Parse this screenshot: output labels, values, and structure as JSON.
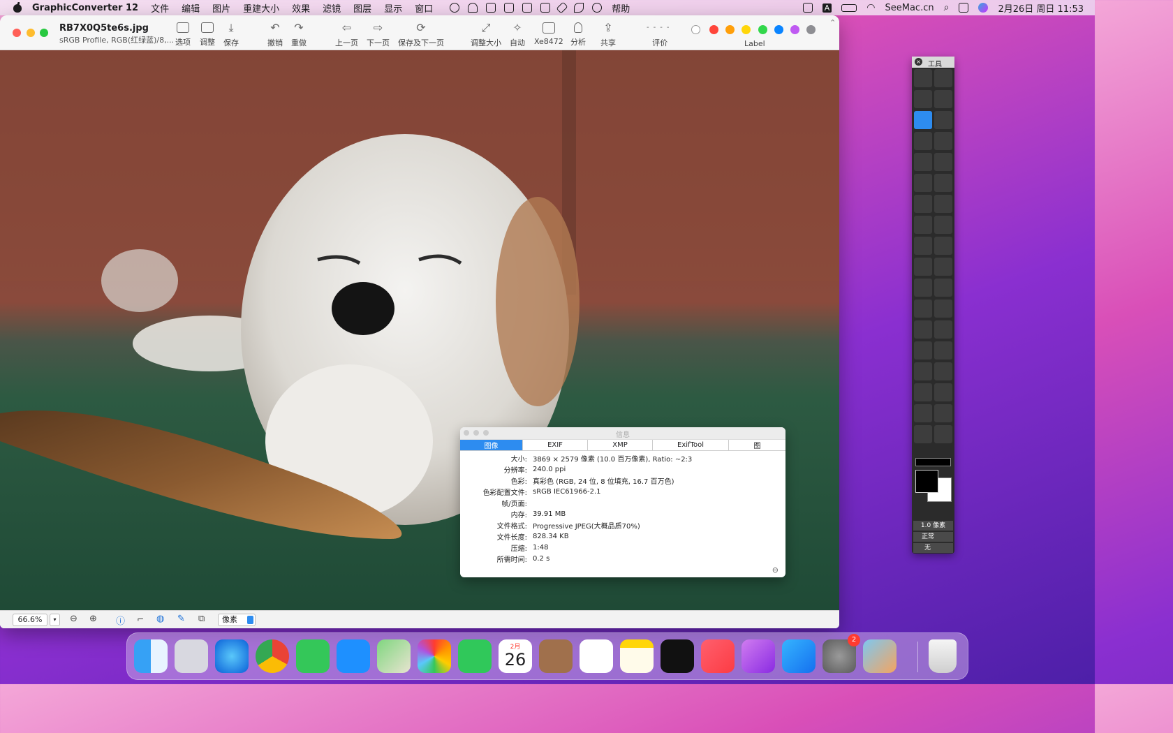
{
  "menubar": {
    "app_name": "GraphicConverter 12",
    "items": [
      "文件",
      "编辑",
      "图片",
      "重建大小",
      "效果",
      "滤镜",
      "图层",
      "显示",
      "窗口",
      "帮助"
    ],
    "right": {
      "site": "SeeMac.cn",
      "input_method": "A",
      "datetime": "2月26日 周日 11:53"
    }
  },
  "window": {
    "title": "RB7X0Q5te6s.jpg",
    "subtitle": "sRGB Profile, RGB(红绿蓝)/8,...",
    "toolbar": {
      "options": "选项",
      "adjust": "调整",
      "save": "保存",
      "undo": "撤销",
      "redo": "重做",
      "prev": "上一页",
      "next": "下一页",
      "save_next": "保存及下一页",
      "resize": "调整大小",
      "auto": "自动",
      "xe": "Xe8472",
      "analyze": "分析",
      "share": "共享",
      "rating": "评价",
      "label": "Label"
    },
    "label_colors": [
      "#ff453a",
      "#ff9f0a",
      "#ffd60a",
      "#32d74b",
      "#0a84ff",
      "#bf5af2",
      "#8e8e93"
    ],
    "statusbar": {
      "zoom": "66.6%",
      "unit": "像素"
    }
  },
  "info_panel": {
    "title": "信息",
    "tabs": [
      "图像",
      "EXIF",
      "XMP",
      "ExifTool",
      "图"
    ],
    "rows": [
      {
        "k": "大小:",
        "v": "3869 × 2579 像素 (10.0 百万像素), Ratio: ~2:3"
      },
      {
        "k": "分辨率:",
        "v": "240.0 ppi"
      },
      {
        "k": "色彩:",
        "v": "真彩色 (RGB, 24 位, 8 位填充, 16.7 百万色)"
      },
      {
        "k": "色彩配置文件:",
        "v": "sRGB IEC61966-2.1"
      },
      {
        "k": "帧/页面:",
        "v": ""
      },
      {
        "k": "内存:",
        "v": "39.91 MB"
      },
      {
        "k": "文件格式:",
        "v": "Progressive JPEG(大概品质70%)"
      },
      {
        "k": "文件长度:",
        "v": "828.34 KB"
      },
      {
        "k": "压缩:",
        "v": "1:48"
      },
      {
        "k": "所需时间:",
        "v": "0.2 s"
      }
    ]
  },
  "tools_palette": {
    "title": "工具",
    "stroke_width": "1.0 像素",
    "mode": "正常",
    "fill": "无"
  },
  "dock": {
    "calendar": {
      "month": "2月",
      "day": "26"
    },
    "settings_badge": "2"
  }
}
